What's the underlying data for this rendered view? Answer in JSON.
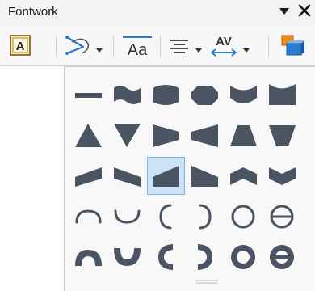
{
  "window": {
    "title": "Fontwork",
    "menu_icon": "triangle-down-icon",
    "close_icon": "close-icon"
  },
  "toolbar": {
    "items": [
      {
        "name": "fontwork-gallery",
        "icon": "fontwork-gallery-icon"
      },
      {
        "name": "fontwork-shape",
        "icon": "fontwork-shape-icon",
        "has_dropdown": true
      },
      {
        "name": "fontwork-same-letter-heights",
        "icon": "same-letter-heights-icon",
        "text": "Aa"
      },
      {
        "name": "fontwork-alignment",
        "icon": "align-center-icon",
        "has_dropdown": true
      },
      {
        "name": "fontwork-character-spacing",
        "icon": "character-spacing-icon",
        "text": "AV",
        "has_dropdown": true
      },
      {
        "name": "extrusion-toggle",
        "icon": "extrusion-icon"
      }
    ]
  },
  "shape_gallery": {
    "selected_index": 14,
    "shapes": [
      "plain-text",
      "wave",
      "inflate",
      "stop",
      "curve-down",
      "deflate-top",
      "triangle-up",
      "triangle-down",
      "fade-right",
      "fade-left",
      "fade-up",
      "fade-down",
      "slant-up",
      "slant-down",
      "fade-up-and-right",
      "fade-up-and-left",
      "chevron-up",
      "chevron-down",
      "arch-up-curve",
      "arch-down-curve",
      "arch-left-curve",
      "arch-right-curve",
      "circle-curve",
      "open-circle-curve",
      "arch-up-pour",
      "arch-down-pour",
      "arch-left-pour",
      "arch-right-pour",
      "circle-pour",
      "open-circle-pour"
    ]
  },
  "colors": {
    "shape_fill": "#4a5462",
    "selection_bg": "#cce4f7",
    "selection_border": "#7eb4ea",
    "accent_blue": "#2b7bd1",
    "accent_orange": "#ee8a1a"
  }
}
